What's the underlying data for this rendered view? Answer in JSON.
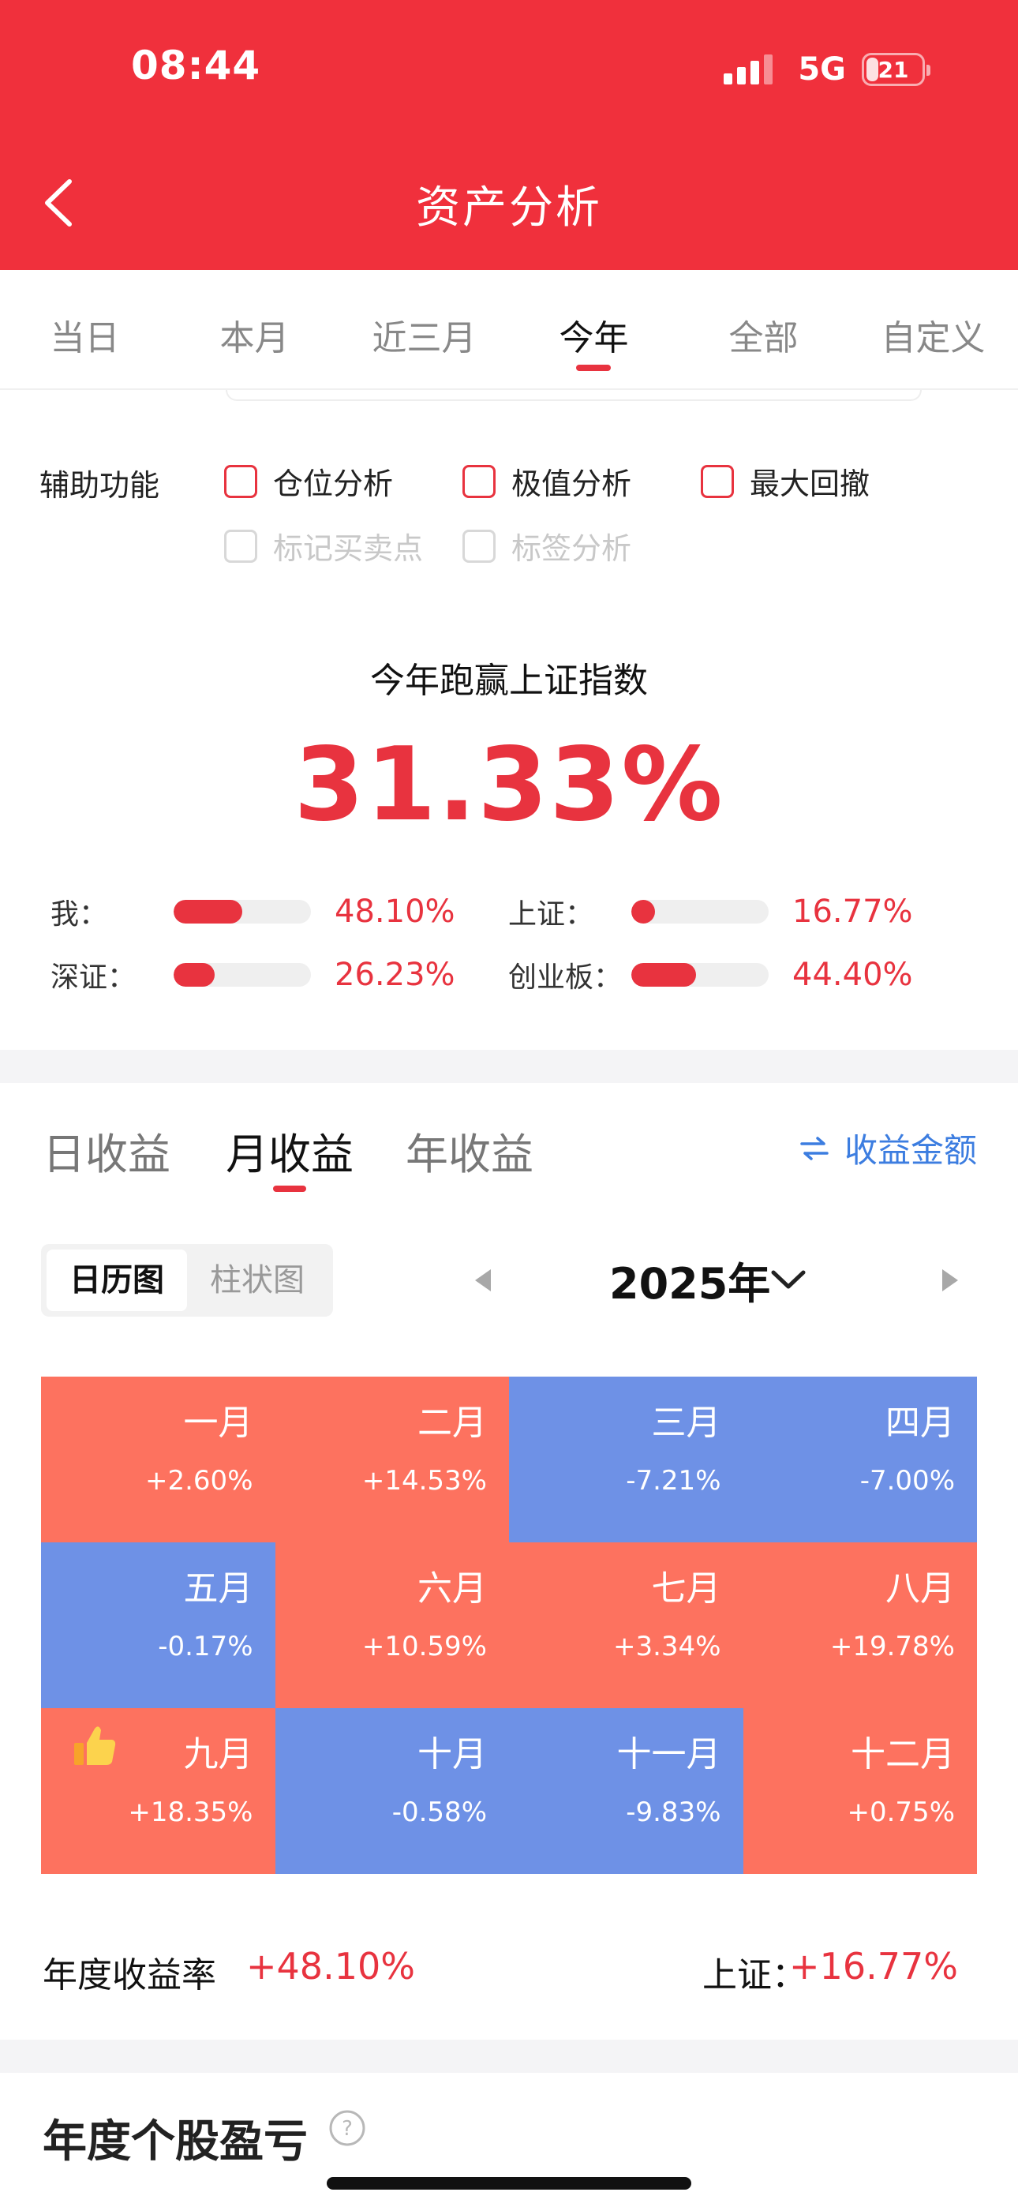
{
  "status_bar": {
    "time": "08:44",
    "network": "5G",
    "battery": "21"
  },
  "header": {
    "title": "资产分析"
  },
  "range_tabs": [
    {
      "label": "当日",
      "active": false
    },
    {
      "label": "本月",
      "active": false
    },
    {
      "label": "近三月",
      "active": false
    },
    {
      "label": "今年",
      "active": true
    },
    {
      "label": "全部",
      "active": false
    },
    {
      "label": "自定义",
      "active": false
    }
  ],
  "aux": {
    "label": "辅助功能",
    "options": [
      {
        "label": "仓位分析",
        "enabled": true,
        "checked": false
      },
      {
        "label": "极值分析",
        "enabled": true,
        "checked": false
      },
      {
        "label": "最大回撤",
        "enabled": true,
        "checked": false
      },
      {
        "label": "标记买卖点",
        "enabled": false,
        "checked": false
      },
      {
        "label": "标签分析",
        "enabled": false,
        "checked": false
      }
    ]
  },
  "headline": {
    "title": "今年跑赢上证指数",
    "value": "31.33%"
  },
  "comparison": [
    {
      "label": "我：",
      "value": "48.10%",
      "fraction": 0.5
    },
    {
      "label": "上证：",
      "value": "16.77%",
      "fraction": 0.17
    },
    {
      "label": "深证：",
      "value": "26.23%",
      "fraction": 0.3
    },
    {
      "label": "创业板：",
      "value": "44.40%",
      "fraction": 0.47
    }
  ],
  "returns_tabs": [
    {
      "label": "日收益",
      "active": false
    },
    {
      "label": "月收益",
      "active": true
    },
    {
      "label": "年收益",
      "active": false
    }
  ],
  "amount_link": {
    "label": "收益金额",
    "icon": "swap-arrows-icon",
    "color": "#3c7de0"
  },
  "view_toggle": [
    {
      "label": "日历图",
      "active": true
    },
    {
      "label": "柱状图",
      "active": false
    }
  ],
  "year_selector": {
    "label": "2025年"
  },
  "colors": {
    "accent": "#f0303c",
    "positive": "#fd725f",
    "negative": "#6e91e6",
    "text_red": "#e8333f"
  },
  "chart_data": {
    "type": "heatmap",
    "categories": [
      "一月",
      "二月",
      "三月",
      "四月",
      "五月",
      "六月",
      "七月",
      "八月",
      "九月",
      "十月",
      "十一月",
      "十二月"
    ],
    "labels": [
      "+2.60%",
      "+14.53%",
      "-7.21%",
      "-7.00%",
      "-0.17%",
      "+10.59%",
      "+3.34%",
      "+19.78%",
      "+18.35%",
      "-0.58%",
      "-9.83%",
      "+0.75%"
    ],
    "values": [
      2.6,
      14.53,
      -7.21,
      -7.0,
      -0.17,
      10.59,
      3.34,
      19.78,
      18.35,
      -0.58,
      -9.83,
      0.75
    ],
    "highlight": {
      "month": "九月",
      "icon": "thumbs-up-icon"
    }
  },
  "summary": {
    "annual_label": "年度收益率",
    "annual_value": "+48.10%",
    "sh_label": "上证：",
    "sh_value": "+16.77%"
  },
  "section": {
    "title": "年度个股盈亏",
    "icon": "help-icon"
  }
}
